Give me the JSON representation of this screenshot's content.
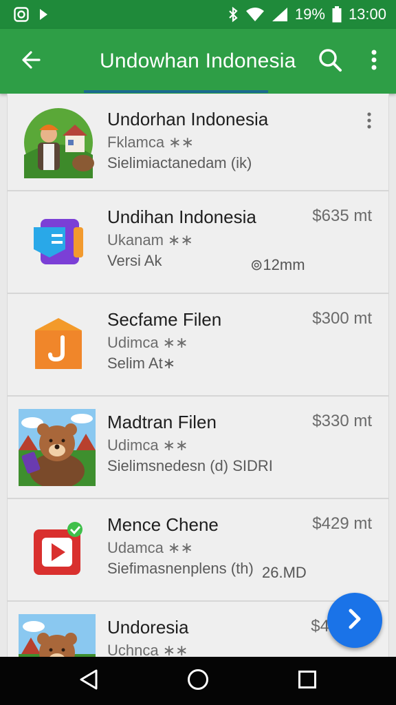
{
  "status_bar": {
    "battery": "19%",
    "time": "13:00",
    "icons": [
      "instagram-icon",
      "play-icon",
      "bluetooth-icon",
      "wifi-icon",
      "signal-icon",
      "battery-icon"
    ]
  },
  "app_bar": {
    "title": "Undowhan Indonesia",
    "icons": [
      "back-arrow-icon",
      "search-icon",
      "more-vert-icon"
    ]
  },
  "colors": {
    "status_bar": "#1f8a3a",
    "app_bar": "#2e9e46",
    "fab": "#1a73e8"
  },
  "list": {
    "items": [
      {
        "name": "Undorhan Indonesia",
        "subtitle": "Fklamca ∗∗",
        "meta": "Sielimiactanedam (ik)",
        "price": "",
        "size": ""
      },
      {
        "name": "Undihan Indonesia",
        "subtitle": "Ukanam ∗∗",
        "meta": "Versi Ak",
        "price": "$635 mt",
        "size": "⊚12mm"
      },
      {
        "name": "Secfame Filen",
        "subtitle": "Udimca ∗∗",
        "meta": "Selim At∗",
        "price": "$300 mt",
        "size": ""
      },
      {
        "name": "Madtran Filen",
        "subtitle": "Udimca ∗∗",
        "meta": "Sielimsnedesn (d)  SIDRI",
        "price": "$330 mt",
        "size": ""
      },
      {
        "name": "Mence Chene",
        "subtitle": "Udamca ∗∗",
        "meta": "Siefimasnenplens (th)",
        "price": "$429 mt",
        "size": "26.MD"
      },
      {
        "name": "Undoresia",
        "subtitle": "Uchnca ∗∗",
        "meta": "",
        "price": "$4",
        "size": ""
      }
    ]
  },
  "fab": {
    "icon": "chevron-right-icon"
  },
  "nav_bar": {
    "icons": [
      "back-triangle-icon",
      "home-circle-icon",
      "recents-square-icon"
    ]
  }
}
